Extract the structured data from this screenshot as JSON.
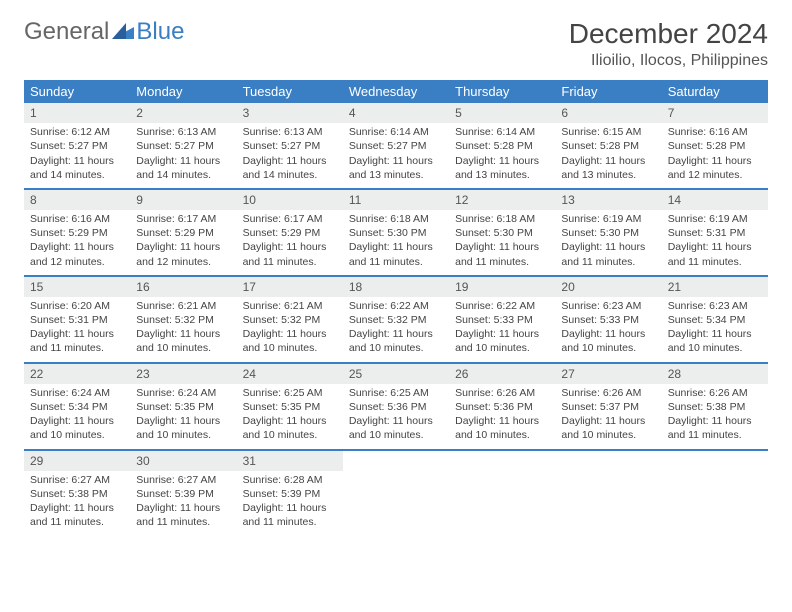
{
  "logo": {
    "part1": "General",
    "part2": "Blue"
  },
  "title": "December 2024",
  "location": "Ilioilio, Ilocos, Philippines",
  "dayHeaders": [
    "Sunday",
    "Monday",
    "Tuesday",
    "Wednesday",
    "Thursday",
    "Friday",
    "Saturday"
  ],
  "weeks": [
    [
      {
        "n": "1",
        "sr": "Sunrise: 6:12 AM",
        "ss": "Sunset: 5:27 PM",
        "d1": "Daylight: 11 hours",
        "d2": "and 14 minutes."
      },
      {
        "n": "2",
        "sr": "Sunrise: 6:13 AM",
        "ss": "Sunset: 5:27 PM",
        "d1": "Daylight: 11 hours",
        "d2": "and 14 minutes."
      },
      {
        "n": "3",
        "sr": "Sunrise: 6:13 AM",
        "ss": "Sunset: 5:27 PM",
        "d1": "Daylight: 11 hours",
        "d2": "and 14 minutes."
      },
      {
        "n": "4",
        "sr": "Sunrise: 6:14 AM",
        "ss": "Sunset: 5:27 PM",
        "d1": "Daylight: 11 hours",
        "d2": "and 13 minutes."
      },
      {
        "n": "5",
        "sr": "Sunrise: 6:14 AM",
        "ss": "Sunset: 5:28 PM",
        "d1": "Daylight: 11 hours",
        "d2": "and 13 minutes."
      },
      {
        "n": "6",
        "sr": "Sunrise: 6:15 AM",
        "ss": "Sunset: 5:28 PM",
        "d1": "Daylight: 11 hours",
        "d2": "and 13 minutes."
      },
      {
        "n": "7",
        "sr": "Sunrise: 6:16 AM",
        "ss": "Sunset: 5:28 PM",
        "d1": "Daylight: 11 hours",
        "d2": "and 12 minutes."
      }
    ],
    [
      {
        "n": "8",
        "sr": "Sunrise: 6:16 AM",
        "ss": "Sunset: 5:29 PM",
        "d1": "Daylight: 11 hours",
        "d2": "and 12 minutes."
      },
      {
        "n": "9",
        "sr": "Sunrise: 6:17 AM",
        "ss": "Sunset: 5:29 PM",
        "d1": "Daylight: 11 hours",
        "d2": "and 12 minutes."
      },
      {
        "n": "10",
        "sr": "Sunrise: 6:17 AM",
        "ss": "Sunset: 5:29 PM",
        "d1": "Daylight: 11 hours",
        "d2": "and 11 minutes."
      },
      {
        "n": "11",
        "sr": "Sunrise: 6:18 AM",
        "ss": "Sunset: 5:30 PM",
        "d1": "Daylight: 11 hours",
        "d2": "and 11 minutes."
      },
      {
        "n": "12",
        "sr": "Sunrise: 6:18 AM",
        "ss": "Sunset: 5:30 PM",
        "d1": "Daylight: 11 hours",
        "d2": "and 11 minutes."
      },
      {
        "n": "13",
        "sr": "Sunrise: 6:19 AM",
        "ss": "Sunset: 5:30 PM",
        "d1": "Daylight: 11 hours",
        "d2": "and 11 minutes."
      },
      {
        "n": "14",
        "sr": "Sunrise: 6:19 AM",
        "ss": "Sunset: 5:31 PM",
        "d1": "Daylight: 11 hours",
        "d2": "and 11 minutes."
      }
    ],
    [
      {
        "n": "15",
        "sr": "Sunrise: 6:20 AM",
        "ss": "Sunset: 5:31 PM",
        "d1": "Daylight: 11 hours",
        "d2": "and 11 minutes."
      },
      {
        "n": "16",
        "sr": "Sunrise: 6:21 AM",
        "ss": "Sunset: 5:32 PM",
        "d1": "Daylight: 11 hours",
        "d2": "and 10 minutes."
      },
      {
        "n": "17",
        "sr": "Sunrise: 6:21 AM",
        "ss": "Sunset: 5:32 PM",
        "d1": "Daylight: 11 hours",
        "d2": "and 10 minutes."
      },
      {
        "n": "18",
        "sr": "Sunrise: 6:22 AM",
        "ss": "Sunset: 5:32 PM",
        "d1": "Daylight: 11 hours",
        "d2": "and 10 minutes."
      },
      {
        "n": "19",
        "sr": "Sunrise: 6:22 AM",
        "ss": "Sunset: 5:33 PM",
        "d1": "Daylight: 11 hours",
        "d2": "and 10 minutes."
      },
      {
        "n": "20",
        "sr": "Sunrise: 6:23 AM",
        "ss": "Sunset: 5:33 PM",
        "d1": "Daylight: 11 hours",
        "d2": "and 10 minutes."
      },
      {
        "n": "21",
        "sr": "Sunrise: 6:23 AM",
        "ss": "Sunset: 5:34 PM",
        "d1": "Daylight: 11 hours",
        "d2": "and 10 minutes."
      }
    ],
    [
      {
        "n": "22",
        "sr": "Sunrise: 6:24 AM",
        "ss": "Sunset: 5:34 PM",
        "d1": "Daylight: 11 hours",
        "d2": "and 10 minutes."
      },
      {
        "n": "23",
        "sr": "Sunrise: 6:24 AM",
        "ss": "Sunset: 5:35 PM",
        "d1": "Daylight: 11 hours",
        "d2": "and 10 minutes."
      },
      {
        "n": "24",
        "sr": "Sunrise: 6:25 AM",
        "ss": "Sunset: 5:35 PM",
        "d1": "Daylight: 11 hours",
        "d2": "and 10 minutes."
      },
      {
        "n": "25",
        "sr": "Sunrise: 6:25 AM",
        "ss": "Sunset: 5:36 PM",
        "d1": "Daylight: 11 hours",
        "d2": "and 10 minutes."
      },
      {
        "n": "26",
        "sr": "Sunrise: 6:26 AM",
        "ss": "Sunset: 5:36 PM",
        "d1": "Daylight: 11 hours",
        "d2": "and 10 minutes."
      },
      {
        "n": "27",
        "sr": "Sunrise: 6:26 AM",
        "ss": "Sunset: 5:37 PM",
        "d1": "Daylight: 11 hours",
        "d2": "and 10 minutes."
      },
      {
        "n": "28",
        "sr": "Sunrise: 6:26 AM",
        "ss": "Sunset: 5:38 PM",
        "d1": "Daylight: 11 hours",
        "d2": "and 11 minutes."
      }
    ],
    [
      {
        "n": "29",
        "sr": "Sunrise: 6:27 AM",
        "ss": "Sunset: 5:38 PM",
        "d1": "Daylight: 11 hours",
        "d2": "and 11 minutes."
      },
      {
        "n": "30",
        "sr": "Sunrise: 6:27 AM",
        "ss": "Sunset: 5:39 PM",
        "d1": "Daylight: 11 hours",
        "d2": "and 11 minutes."
      },
      {
        "n": "31",
        "sr": "Sunrise: 6:28 AM",
        "ss": "Sunset: 5:39 PM",
        "d1": "Daylight: 11 hours",
        "d2": "and 11 minutes."
      },
      null,
      null,
      null,
      null
    ]
  ]
}
